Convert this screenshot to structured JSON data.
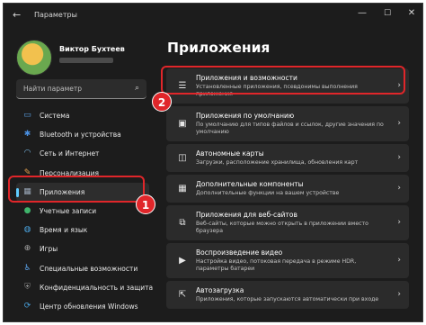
{
  "window": {
    "title": "Параметры",
    "back_glyph": "←",
    "minimize_glyph": "—",
    "maximize_glyph": "☐",
    "close_glyph": "✕"
  },
  "profile": {
    "name": "Виктор Бухтеев"
  },
  "search": {
    "placeholder": "Найти параметр",
    "icon": "search-icon"
  },
  "sidebar": {
    "items": [
      {
        "label": "Система",
        "icon": "monitor-icon",
        "glyph": "▭",
        "color": "#5aa0e6"
      },
      {
        "label": "Bluetooth и устройства",
        "icon": "bluetooth-icon",
        "glyph": "✱",
        "color": "#4a90e2"
      },
      {
        "label": "Сеть и Интернет",
        "icon": "wifi-icon",
        "glyph": "◠",
        "color": "#7fc0ee"
      },
      {
        "label": "Персонализация",
        "icon": "brush-icon",
        "glyph": "✎",
        "color": "#e6a14e"
      },
      {
        "label": "Приложения",
        "icon": "apps-icon",
        "glyph": "▦",
        "color": "#9aa7b8"
      },
      {
        "label": "Учетные записи",
        "icon": "account-icon",
        "glyph": "●",
        "color": "#3fb46b"
      },
      {
        "label": "Время и язык",
        "icon": "globe-icon",
        "glyph": "◍",
        "color": "#4aa3df"
      },
      {
        "label": "Игры",
        "icon": "gamepad-icon",
        "glyph": "⊕",
        "color": "#a8a8a8"
      },
      {
        "label": "Специальные возможности",
        "icon": "accessibility-icon",
        "glyph": "♿",
        "color": "#5aa0e6"
      },
      {
        "label": "Конфиденциальность и защита",
        "icon": "shield-icon",
        "glyph": "⛨",
        "color": "#8d8d8d"
      },
      {
        "label": "Центр обновления Windows",
        "icon": "update-icon",
        "glyph": "⟳",
        "color": "#4aa3df"
      }
    ],
    "selected_index": 4
  },
  "main": {
    "title": "Приложения",
    "cards": [
      {
        "title": "Приложения и возможности",
        "subtitle": "Установленные приложения, псевдонимы выполнения приложения",
        "icon": "list-icon",
        "glyph": "☰"
      },
      {
        "title": "Приложения по умолчанию",
        "subtitle": "По умолчанию для типов файлов и ссылок, другие значения по умолчанию",
        "icon": "default-apps-icon",
        "glyph": "▣"
      },
      {
        "title": "Автономные карты",
        "subtitle": "Загрузки, расположение хранилища, обновления карт",
        "icon": "map-icon",
        "glyph": "◫"
      },
      {
        "title": "Дополнительные компоненты",
        "subtitle": "Дополнительные функции на вашем устройстве",
        "icon": "components-icon",
        "glyph": "▦"
      },
      {
        "title": "Приложения для веб-сайтов",
        "subtitle": "Веб-сайты, которые можно открыть в приложении вместо браузера",
        "icon": "web-apps-icon",
        "glyph": "⧉"
      },
      {
        "title": "Воспроизведение видео",
        "subtitle": "Настройка видео, потоковая передача в режиме HDR, параметры батареи",
        "icon": "video-icon",
        "glyph": "▶"
      },
      {
        "title": "Автозагрузка",
        "subtitle": "Приложения, которые запускаются автоматически при входе",
        "icon": "startup-icon",
        "glyph": "⇱"
      }
    ],
    "chevron": "›"
  },
  "annotations": {
    "marker_1": "1",
    "marker_2": "2",
    "color": "#e0262a"
  }
}
